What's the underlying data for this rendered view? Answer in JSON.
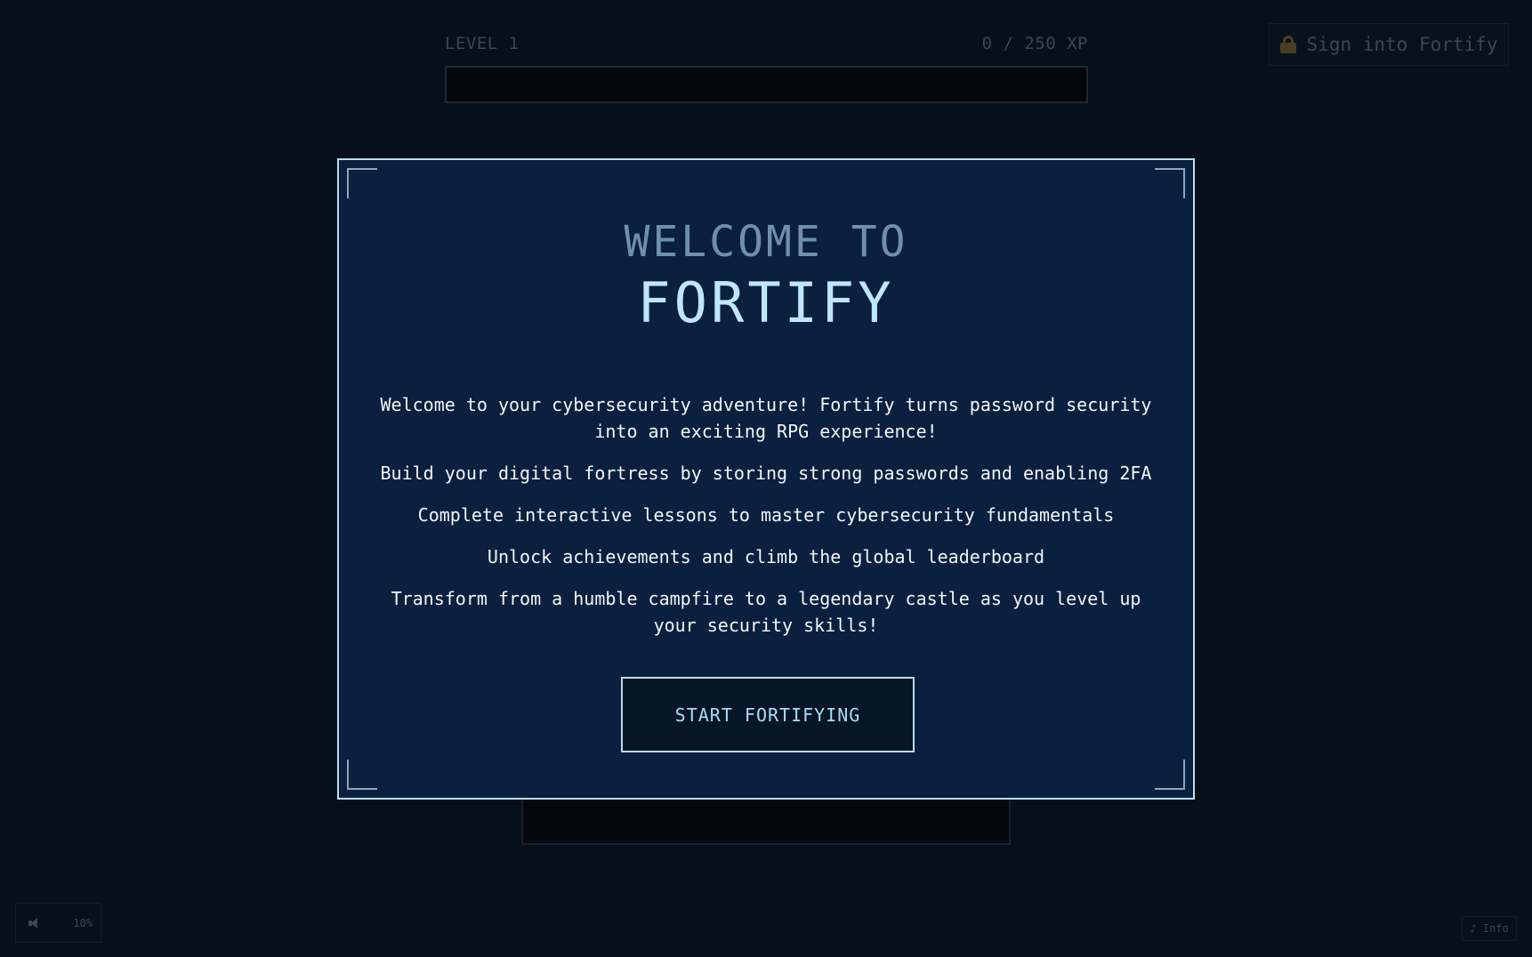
{
  "background": {
    "level_label": "LEVEL 1",
    "xp_text": "0 / 250 XP",
    "xp_progress": 0,
    "signin": {
      "icon": "lock-icon",
      "label": "Sign into Fortify"
    },
    "volume": {
      "icon": "speaker-icon",
      "level": "10%"
    },
    "info": {
      "label": "♪ Info"
    }
  },
  "modal": {
    "welcome": "WELCOME TO",
    "title": "FORTIFY",
    "paragraphs": [
      "Welcome to your cybersecurity adventure! Fortify turns password security into an exciting RPG experience!",
      "Build your digital fortress by storing strong passwords and enabling 2FA",
      "Complete interactive lessons to master cybersecurity fundamentals",
      "Unlock achievements and climb the global leaderboard",
      "Transform from a humble campfire to a legendary castle as you level up your security skills!"
    ],
    "start_button": "START FORTIFYING"
  },
  "colors": {
    "accent": "#bfe6fb",
    "modal_bg": "#0a203e",
    "page_bg": "#030a13",
    "border": "#b9ddec"
  }
}
